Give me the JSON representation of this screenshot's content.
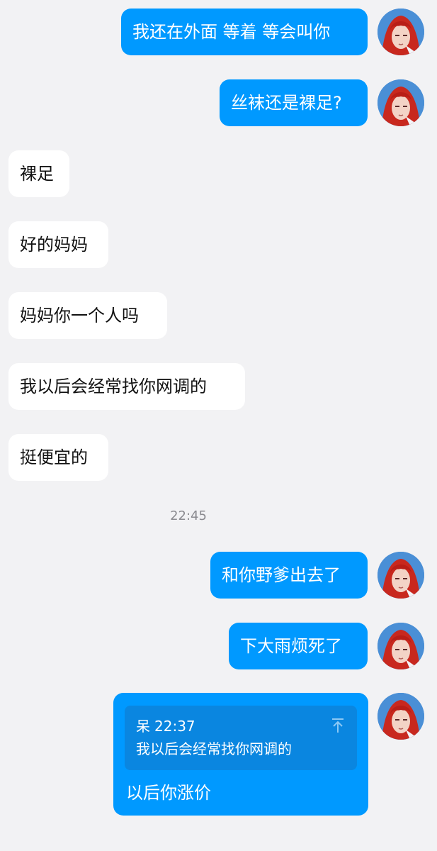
{
  "messages": [
    {
      "side": "out",
      "text": "我还在外面 等着 等会叫你"
    },
    {
      "side": "out",
      "text": "丝袜还是裸足?"
    },
    {
      "side": "in",
      "text": "裸足"
    },
    {
      "side": "in",
      "text": "好的妈妈"
    },
    {
      "side": "in",
      "text": "妈妈你一个人吗"
    },
    {
      "side": "in",
      "text": "我以后会经常找你网调的"
    },
    {
      "side": "in",
      "text": "挺便宜的"
    },
    {
      "side": "out",
      "text": "和你野爹出去了"
    },
    {
      "side": "out",
      "text": "下大雨烦死了"
    }
  ],
  "timestamp": "22:45",
  "quoted_reply": {
    "quote_sender": "呆",
    "quote_time": "22:37",
    "quote_text": "我以后会经常找你网调的",
    "reply_text": "以后你涨价",
    "jump_icon": "jump-to-original-icon"
  },
  "colors": {
    "background": "#f2f2f4",
    "outgoing_bubble": "#0099ff",
    "incoming_bubble": "#ffffff",
    "quote_box": "#0a86e0",
    "timestamp_text": "#8a8a8f"
  },
  "avatar_icon": "red-haired-anime-avatar"
}
